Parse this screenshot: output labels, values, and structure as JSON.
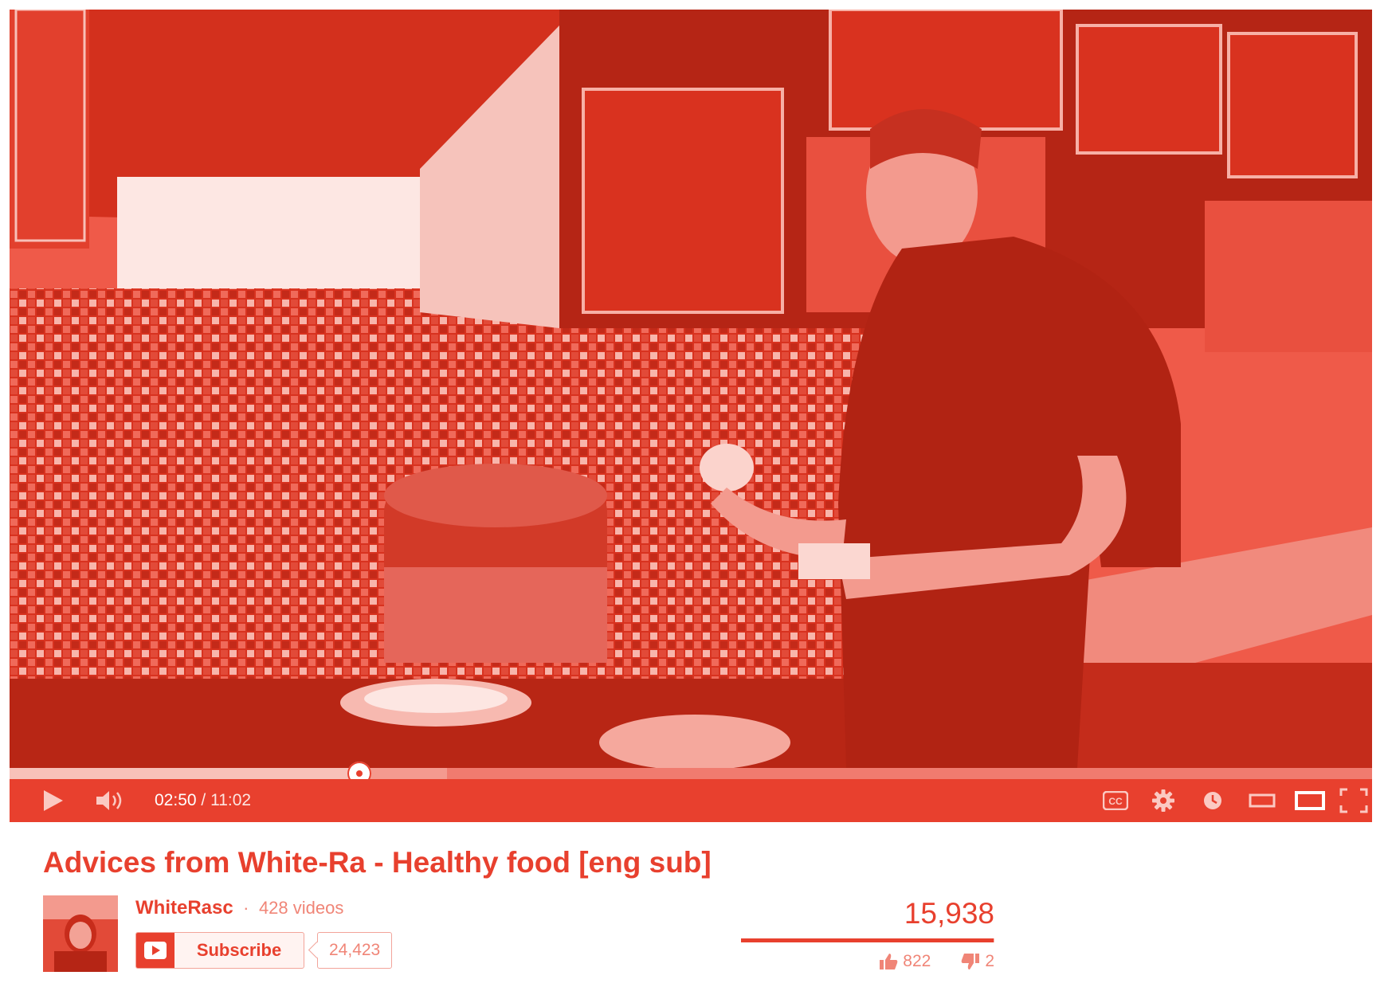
{
  "player": {
    "current_time": "02:50",
    "separator": " / ",
    "duration": "11:02",
    "progress_played_fraction": 0.257,
    "progress_buffered_fraction": 0.321,
    "icons": [
      "play-icon",
      "volume-icon",
      "captions-icon",
      "settings-icon",
      "watch-later-icon",
      "small-player-icon",
      "large-player-icon",
      "fullscreen-icon"
    ],
    "captions_label": "CC"
  },
  "video": {
    "title": "Advices from White-Ra - Healthy food [eng sub]"
  },
  "channel": {
    "name": "WhiteRasc",
    "separator": "·",
    "video_count": "428 videos",
    "subscribe_label": "Subscribe",
    "subscriber_count": "24,423"
  },
  "stats": {
    "views": "15,938",
    "likes": "822",
    "dislikes": "2",
    "like_fraction": 0.998
  },
  "colors": {
    "accent": "#e8402e",
    "light_accent": "#f08577",
    "background": "#ffffff"
  }
}
